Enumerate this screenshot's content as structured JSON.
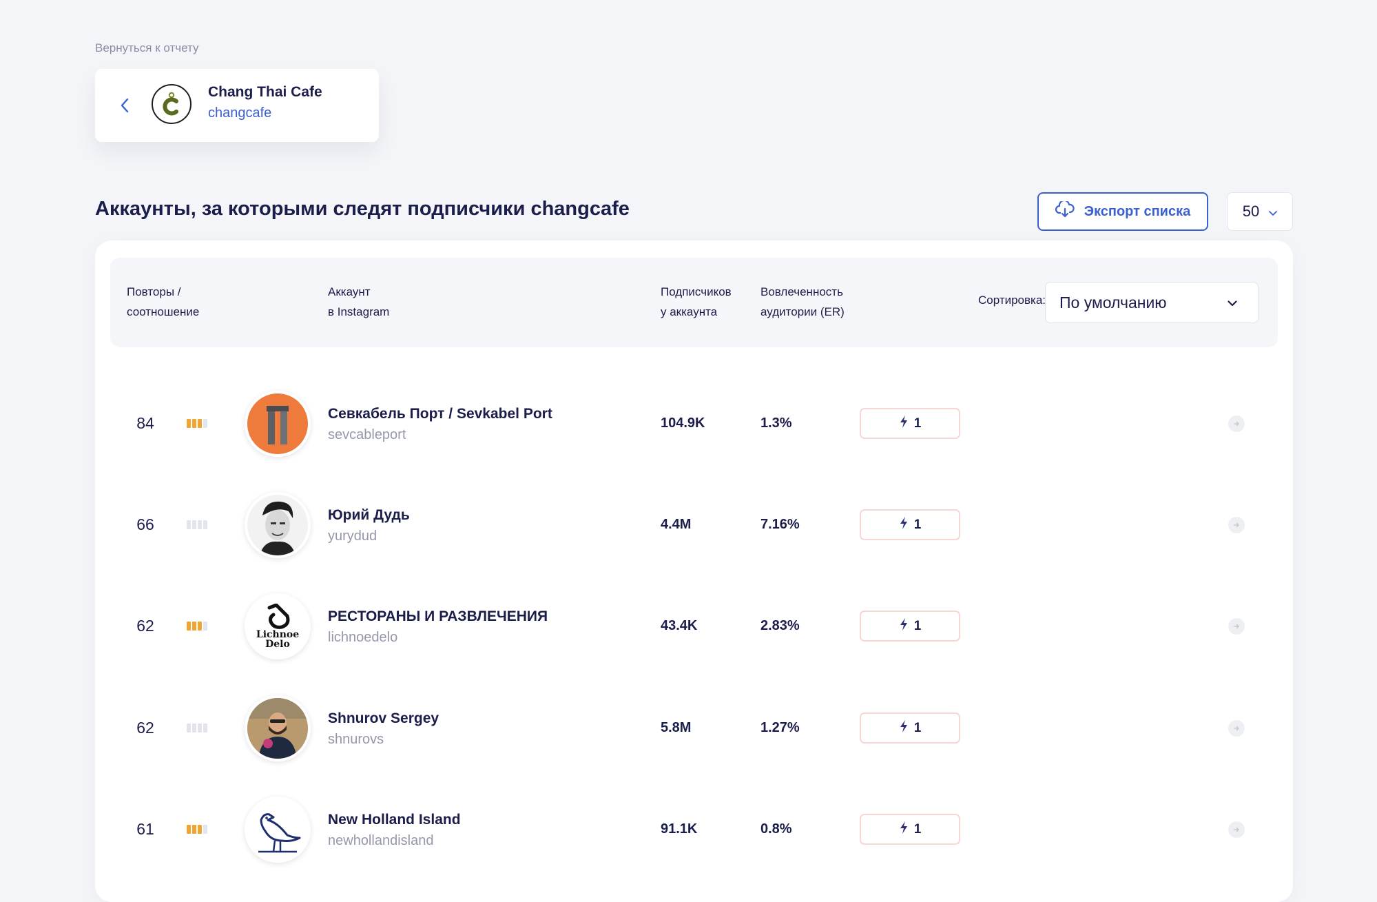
{
  "back_link": "Вернуться к отчету",
  "account": {
    "name": "Chang Thai Cafe",
    "handle": "changcafe",
    "logo_letter": "c"
  },
  "title": "Аккаунты, за которыми следят подписчики changcafe",
  "export_button": "Экспорт списка",
  "per_page": "50",
  "table": {
    "headers": {
      "repeats_line1": "Повторы /",
      "repeats_line2": "соотношение",
      "account_line1": "Аккаунт",
      "account_line2": "в Instagram",
      "followers_line1": "Подписчиков",
      "followers_line2": "у аккаунта",
      "er_line1": "Вовлеченность",
      "er_line2": "аудитории (ER)"
    },
    "sort_label": "Сортировка:",
    "sort_value": "По умолчанию",
    "rows": [
      {
        "repeats": "84",
        "ratio_level": 3,
        "name": "Севкабель Порт / Sevkabel Port",
        "handle": "sevcableport",
        "followers": "104.9K",
        "er": "1.3%",
        "badge": "1",
        "avatar": "sevkabel"
      },
      {
        "repeats": "66",
        "ratio_level": 0,
        "name": "Юрий Дудь",
        "handle": "yurydud",
        "followers": "4.4M",
        "er": "7.16%",
        "badge": "1",
        "avatar": "portrait"
      },
      {
        "repeats": "62",
        "ratio_level": 3,
        "name": "РЕСТОРАНЫ И РАЗВЛЕЧЕНИЯ",
        "handle": "lichnoedelo",
        "followers": "43.4K",
        "er": "2.83%",
        "badge": "1",
        "avatar": "lichnoe",
        "avatar_text_1": "Lichnoe",
        "avatar_text_2": "Delo"
      },
      {
        "repeats": "62",
        "ratio_level": 0,
        "name": "Shnurov Sergey",
        "handle": "shnurovs",
        "followers": "5.8M",
        "er": "1.27%",
        "badge": "1",
        "avatar": "photo"
      },
      {
        "repeats": "61",
        "ratio_level": 3,
        "name": "New Holland Island",
        "handle": "newhollandisland",
        "followers": "91.1K",
        "er": "0.8%",
        "badge": "1",
        "avatar": "bird"
      }
    ]
  },
  "colors": {
    "accent": "#3a5fd0",
    "text": "#1b1d4a",
    "muted": "#9598ab",
    "bar_on": "#f0a431",
    "bar_off": "#e3e5ec",
    "sevkabel_orange": "#ee7a3b"
  },
  "icons": {
    "back": "chevron-left-icon",
    "export": "cloud-download-icon",
    "dropdown": "chevron-down-icon",
    "badge": "lightning-icon",
    "row_action": "arrow-right-circle-icon"
  }
}
